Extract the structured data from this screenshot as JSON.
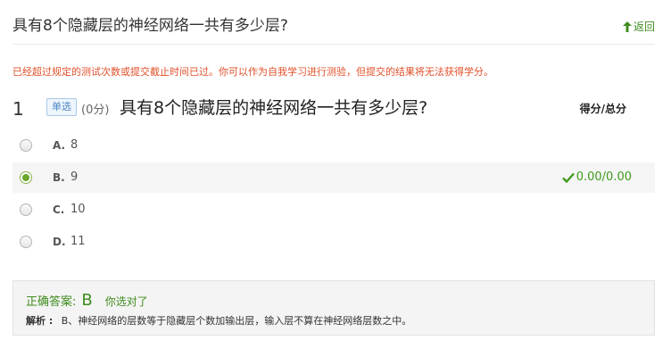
{
  "header": {
    "title": "具有8个隐藏层的神经网络一共有多少层?",
    "back_label": "返回"
  },
  "notice": "已经超过规定的测试次数或提交截止时间已过。你可以作为自我学习进行测验，但提交的结果将无法获得学分。",
  "question": {
    "number": "1",
    "type_label": "单选",
    "score": "(0分)",
    "text": "具有8个隐藏层的神经网络一共有多少层?",
    "score_header": "得分/总分"
  },
  "options": [
    {
      "key": "A.",
      "value": "8",
      "selected": false,
      "score": ""
    },
    {
      "key": "B.",
      "value": "9",
      "selected": true,
      "score": "0.00/0.00"
    },
    {
      "key": "C.",
      "value": "10",
      "selected": false,
      "score": ""
    },
    {
      "key": "D.",
      "value": "11",
      "selected": false,
      "score": ""
    }
  ],
  "answer": {
    "label": "正确答案:",
    "value": "B",
    "result": "你选对了",
    "explanation_label": "解析 :",
    "explanation": "B、神经网络的层数等于隐藏层个数加输出层，输入层不算在神经网络层数之中。"
  },
  "colors": {
    "accent_green": "#3f8c1e",
    "notice_red": "#e0502a",
    "type_blue": "#4b86c4"
  }
}
